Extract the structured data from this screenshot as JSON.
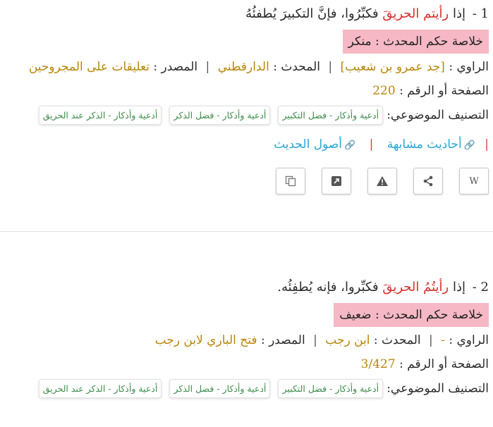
{
  "hadiths": [
    {
      "number": "1 -",
      "text_pre": "إذا",
      "text_red": "رأيتم الحريقَ",
      "text_post": "فكبِّرُوا، فإنَّ التكبيرَ يُطفئُهُ",
      "grade": "خلاصة حكم المحدث : منكر",
      "narrator_label": "الراوي :",
      "narrator": "[جد عمرو بن شعيب]",
      "muhaddith_label": "المحدث :",
      "muhaddith": "الدارقطني",
      "source_label": "المصدر :",
      "source": "تعليقات على المجروحين",
      "page_label": "الصفحة أو الرقم :",
      "page": "220",
      "tags_label": "التصنيف الموضوعي:",
      "tags": [
        "أدعية وأذكار - فضل التكبير",
        "أدعية وأذكار - فضل الذكر",
        "أدعية وأذكار - الذكر عند الحريق"
      ],
      "similar_link": "أحاديث مشابهة",
      "origins_link": "أصول الحديث"
    },
    {
      "number": "2 -",
      "text_pre": "إذا",
      "text_red": "رأيتُمُ الحريقَ",
      "text_post": "فكبِّروا، فإنه يُطفِئُه.",
      "grade": "خلاصة حكم المحدث : ضعيف",
      "narrator_label": "الراوي :",
      "narrator": "-",
      "muhaddith_label": "المحدث :",
      "muhaddith": "ابن رجب",
      "source_label": "المصدر :",
      "source": "فتح الباري لابن رجب",
      "page_label": "الصفحة أو الرقم :",
      "page": "3/427",
      "tags_label": "التصنيف الموضوعي:",
      "tags": [
        "أدعية وأذكار - فضل التكبير",
        "أدعية وأذكار - فضل الذكر",
        "أدعية وأذكار - الذكر عند الحريق"
      ]
    }
  ],
  "action_icons": [
    "wiki-icon",
    "share-icon",
    "warning-icon",
    "external-link-icon",
    "copy-icon"
  ],
  "action_wiki_label": "W",
  "colors": {
    "highlight_red": "#d32f2f",
    "grade_bg": "#f6b8c4",
    "value_gold": "#b8860b",
    "tag_green": "#3d8b4a",
    "link_blue": "#2aa6d4"
  }
}
